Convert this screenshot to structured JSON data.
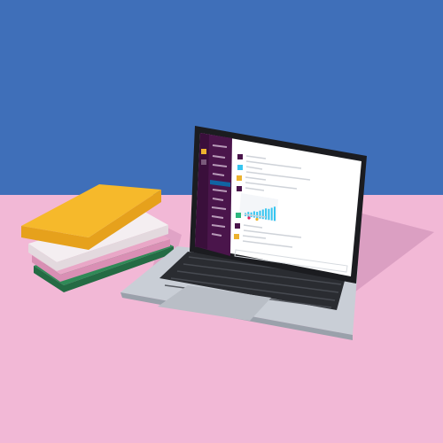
{
  "scene": {
    "colors": {
      "wall": "#3f6fb9",
      "desk": "#f2b8d6",
      "shadow": "#c98ab3",
      "laptop_body": "#c9ced6",
      "laptop_dark": "#2a2c31",
      "screen_bezel": "#1b1c20",
      "sidebar": "#4a154b",
      "sidebar_highlight": "#1164a3",
      "accent_blue": "#36c5f0",
      "accent_green": "#2eb67d",
      "accent_yellow": "#ecb22e",
      "accent_red": "#e01e5a",
      "book_yellow": "#f6b92b",
      "book_white": "#f4eef1",
      "book_green": "#2f8a57",
      "book_pink": "#e9a7c7"
    },
    "objects": [
      "stack-of-notebooks",
      "open-laptop",
      "chat-app-on-screen"
    ]
  },
  "screen_chart": {
    "type": "bar",
    "values": [
      2,
      3,
      3,
      4,
      4,
      5,
      6,
      7,
      7,
      8,
      9
    ]
  }
}
